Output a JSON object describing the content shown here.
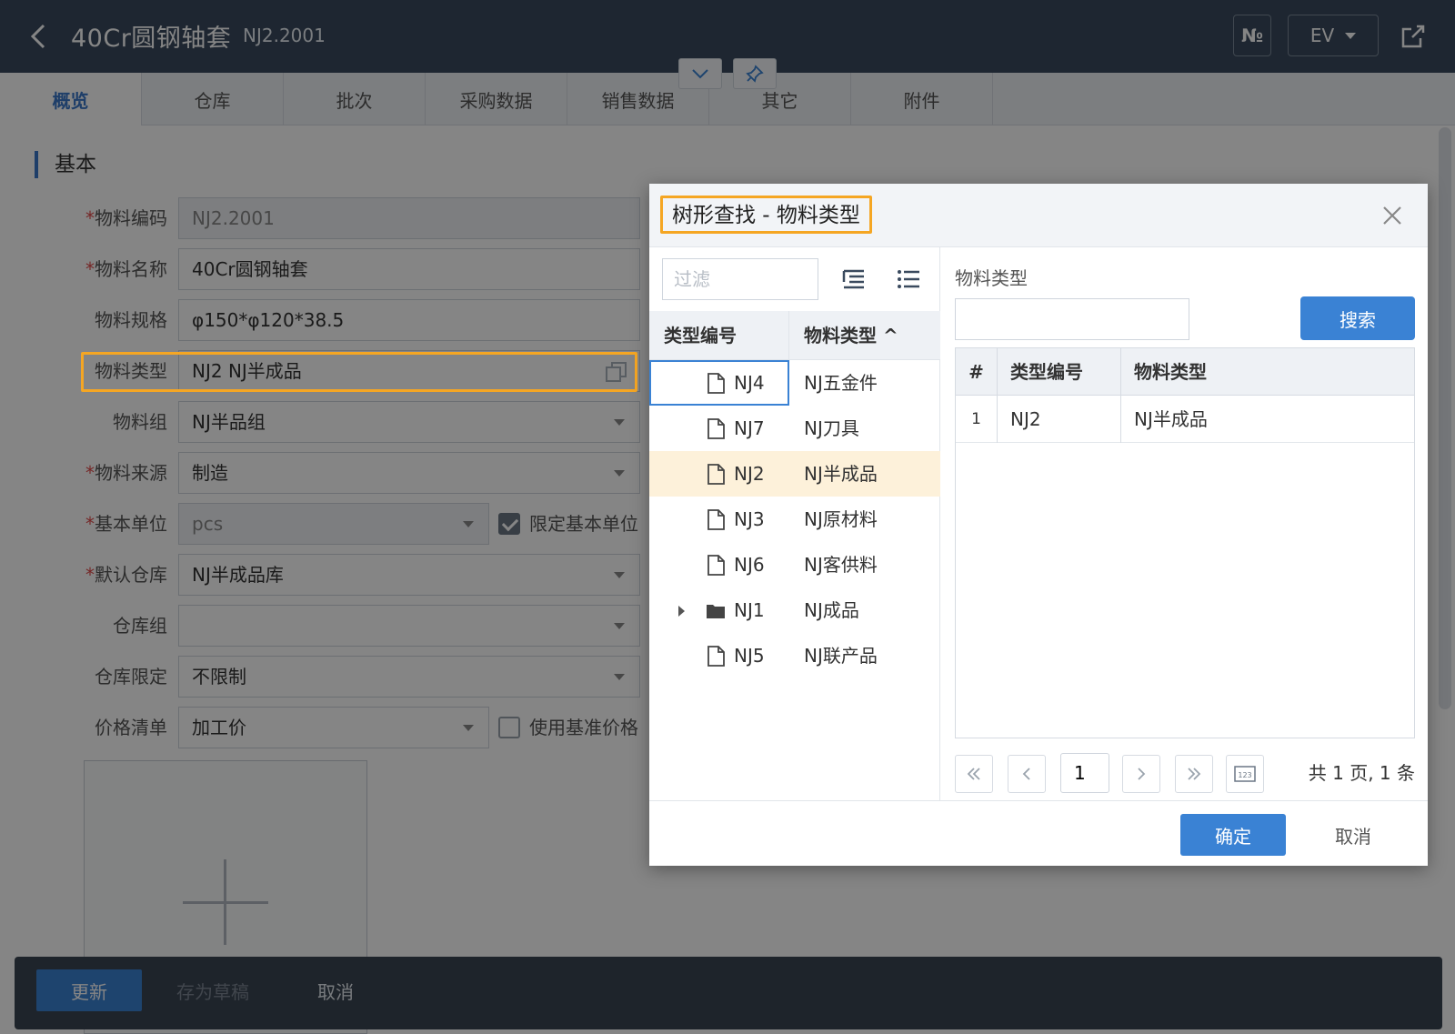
{
  "header": {
    "title": "40Cr圆钢轴套",
    "code": "NJ2.2001",
    "btn_no": "№",
    "btn_ev": "EV"
  },
  "tabs": [
    "概览",
    "仓库",
    "批次",
    "采购数据",
    "销售数据",
    "其它",
    "附件"
  ],
  "section": {
    "title": "基本"
  },
  "form": {
    "rows": [
      {
        "label": "物料编码",
        "required": "*",
        "value": "NJ2.2001"
      },
      {
        "label": "物料名称",
        "required": "*",
        "value": "40Cr圆钢轴套"
      },
      {
        "label": "物料规格",
        "required": "",
        "value": "φ150*φ120*38.5"
      },
      {
        "label": "物料类型",
        "required": "",
        "value": "NJ2 NJ半成品"
      },
      {
        "label": "物料组",
        "required": "",
        "value": "NJ半品组"
      },
      {
        "label": "物料来源",
        "required": "*",
        "value": "制造"
      },
      {
        "label": "基本单位",
        "required": "*",
        "value": "pcs"
      },
      {
        "label": "默认仓库",
        "required": "*",
        "value": "NJ半成品库"
      },
      {
        "label": "仓库组",
        "required": "",
        "value": ""
      },
      {
        "label": "仓库限定",
        "required": "",
        "value": "不限制"
      },
      {
        "label": "价格清单",
        "required": "",
        "value": "加工价"
      }
    ],
    "checkbox_limit_unit": "限定基本单位",
    "checkbox_base_price": "使用基准价格"
  },
  "bottom_bar": {
    "update": "更新",
    "draft": "存为草稿",
    "cancel": "取消"
  },
  "dialog": {
    "title": "树形查找 - 物料类型",
    "filter_placeholder": "过滤",
    "tree_headers": {
      "code": "类型编号",
      "name": "物料类型 ^"
    },
    "tree_rows": [
      {
        "code": "NJ4",
        "name": "NJ五金件",
        "type": "file"
      },
      {
        "code": "NJ7",
        "name": "NJ刀具",
        "type": "file"
      },
      {
        "code": "NJ2",
        "name": "NJ半成品",
        "type": "file"
      },
      {
        "code": "NJ3",
        "name": "NJ原材料",
        "type": "file"
      },
      {
        "code": "NJ6",
        "name": "NJ客供料",
        "type": "file"
      },
      {
        "code": "NJ1",
        "name": "NJ成品",
        "type": "folder"
      },
      {
        "code": "NJ5",
        "name": "NJ联产品",
        "type": "file"
      }
    ],
    "right_label": "物料类型",
    "search_value": "",
    "search_button": "搜索",
    "grid_headers": {
      "index": "#",
      "code": "类型编号",
      "name": "物料类型"
    },
    "grid_rows": [
      {
        "index": "1",
        "code": "NJ2",
        "name": "NJ半成品"
      }
    ],
    "pager": {
      "current_page": "1",
      "info": "共 1 页, 1 条"
    },
    "ok_button": "确定",
    "cancel_button": "取消"
  },
  "colors": {
    "accent": "#3a82d4",
    "highlight": "#f5a623",
    "selected_row": "#fdf1da",
    "required": "#e14b4b"
  }
}
